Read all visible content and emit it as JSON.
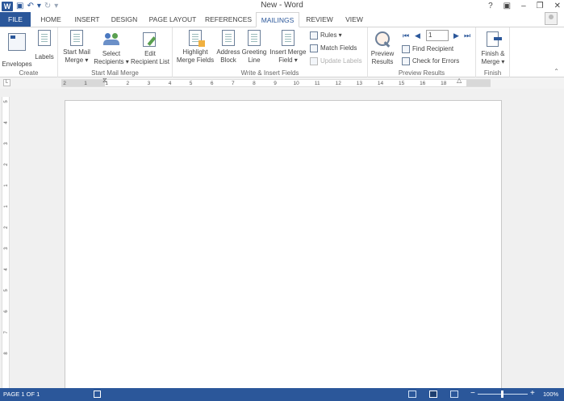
{
  "window": {
    "title": "New - Word",
    "help": "?",
    "ribbon_options": "▣",
    "minimize": "–",
    "restore": "❐",
    "close": "✕"
  },
  "qat": {
    "logo": "W",
    "save": "💾",
    "undo": "↶",
    "undo_dd": "▾",
    "redo": "↻",
    "customize": "▾"
  },
  "tabs": [
    {
      "label": "FILE"
    },
    {
      "label": "HOME"
    },
    {
      "label": "INSERT"
    },
    {
      "label": "DESIGN"
    },
    {
      "label": "PAGE LAYOUT"
    },
    {
      "label": "REFERENCES"
    },
    {
      "label": "MAILINGS"
    },
    {
      "label": "REVIEW"
    },
    {
      "label": "VIEW"
    }
  ],
  "ribbon": {
    "groups": [
      {
        "label": "Create"
      },
      {
        "label": "Start Mail Merge"
      },
      {
        "label": "Write & Insert Fields"
      },
      {
        "label": "Preview Results"
      },
      {
        "label": "Finish"
      }
    ],
    "create": {
      "envelopes": "Envelopes",
      "labels": "Labels"
    },
    "start": {
      "start_mail_merge_1": "Start Mail",
      "start_mail_merge_2": "Merge ▾",
      "select_recipients_1": "Select",
      "select_recipients_2": "Recipients ▾",
      "edit_recipient_1": "Edit",
      "edit_recipient_2": "Recipient List"
    },
    "write": {
      "highlight_1": "Highlight",
      "highlight_2": "Merge Fields",
      "address_1": "Address",
      "address_2": "Block",
      "greeting_1": "Greeting",
      "greeting_2": "Line",
      "insert_merge_1": "Insert Merge",
      "insert_merge_2": "Field ▾",
      "rules": "Rules ▾",
      "match_fields": "Match Fields",
      "update_labels": "Update Labels"
    },
    "preview": {
      "preview_1": "Preview",
      "preview_2": "Results",
      "record_value": "1",
      "find_recipient": "Find Recipient",
      "check_errors": "Check for Errors",
      "first": "⏮",
      "prev": "◀",
      "next": "▶",
      "last": "⏭"
    },
    "finish": {
      "finish_1": "Finish &",
      "finish_2": "Merge ▾"
    },
    "collapse": "⌃"
  },
  "ruler": {
    "corner": "L",
    "ticks": [
      "2",
      "1",
      "1",
      "2",
      "3",
      "4",
      "5",
      "6",
      "7",
      "8",
      "9",
      "10",
      "11",
      "12",
      "13",
      "14",
      "15",
      "16",
      "18"
    ],
    "vticks": [
      "5",
      "4",
      "3",
      "2",
      "1",
      "1",
      "2",
      "3",
      "4",
      "5",
      "6",
      "7",
      "8"
    ]
  },
  "status": {
    "page_info": "PAGE 1 OF 1",
    "zoom_out": "−",
    "zoom_in": "+",
    "zoom": "100%"
  },
  "colors": {
    "accent": "#2b579a",
    "ribbon_bg": "#ffffff",
    "doc_bg": "#f0f0f0"
  }
}
